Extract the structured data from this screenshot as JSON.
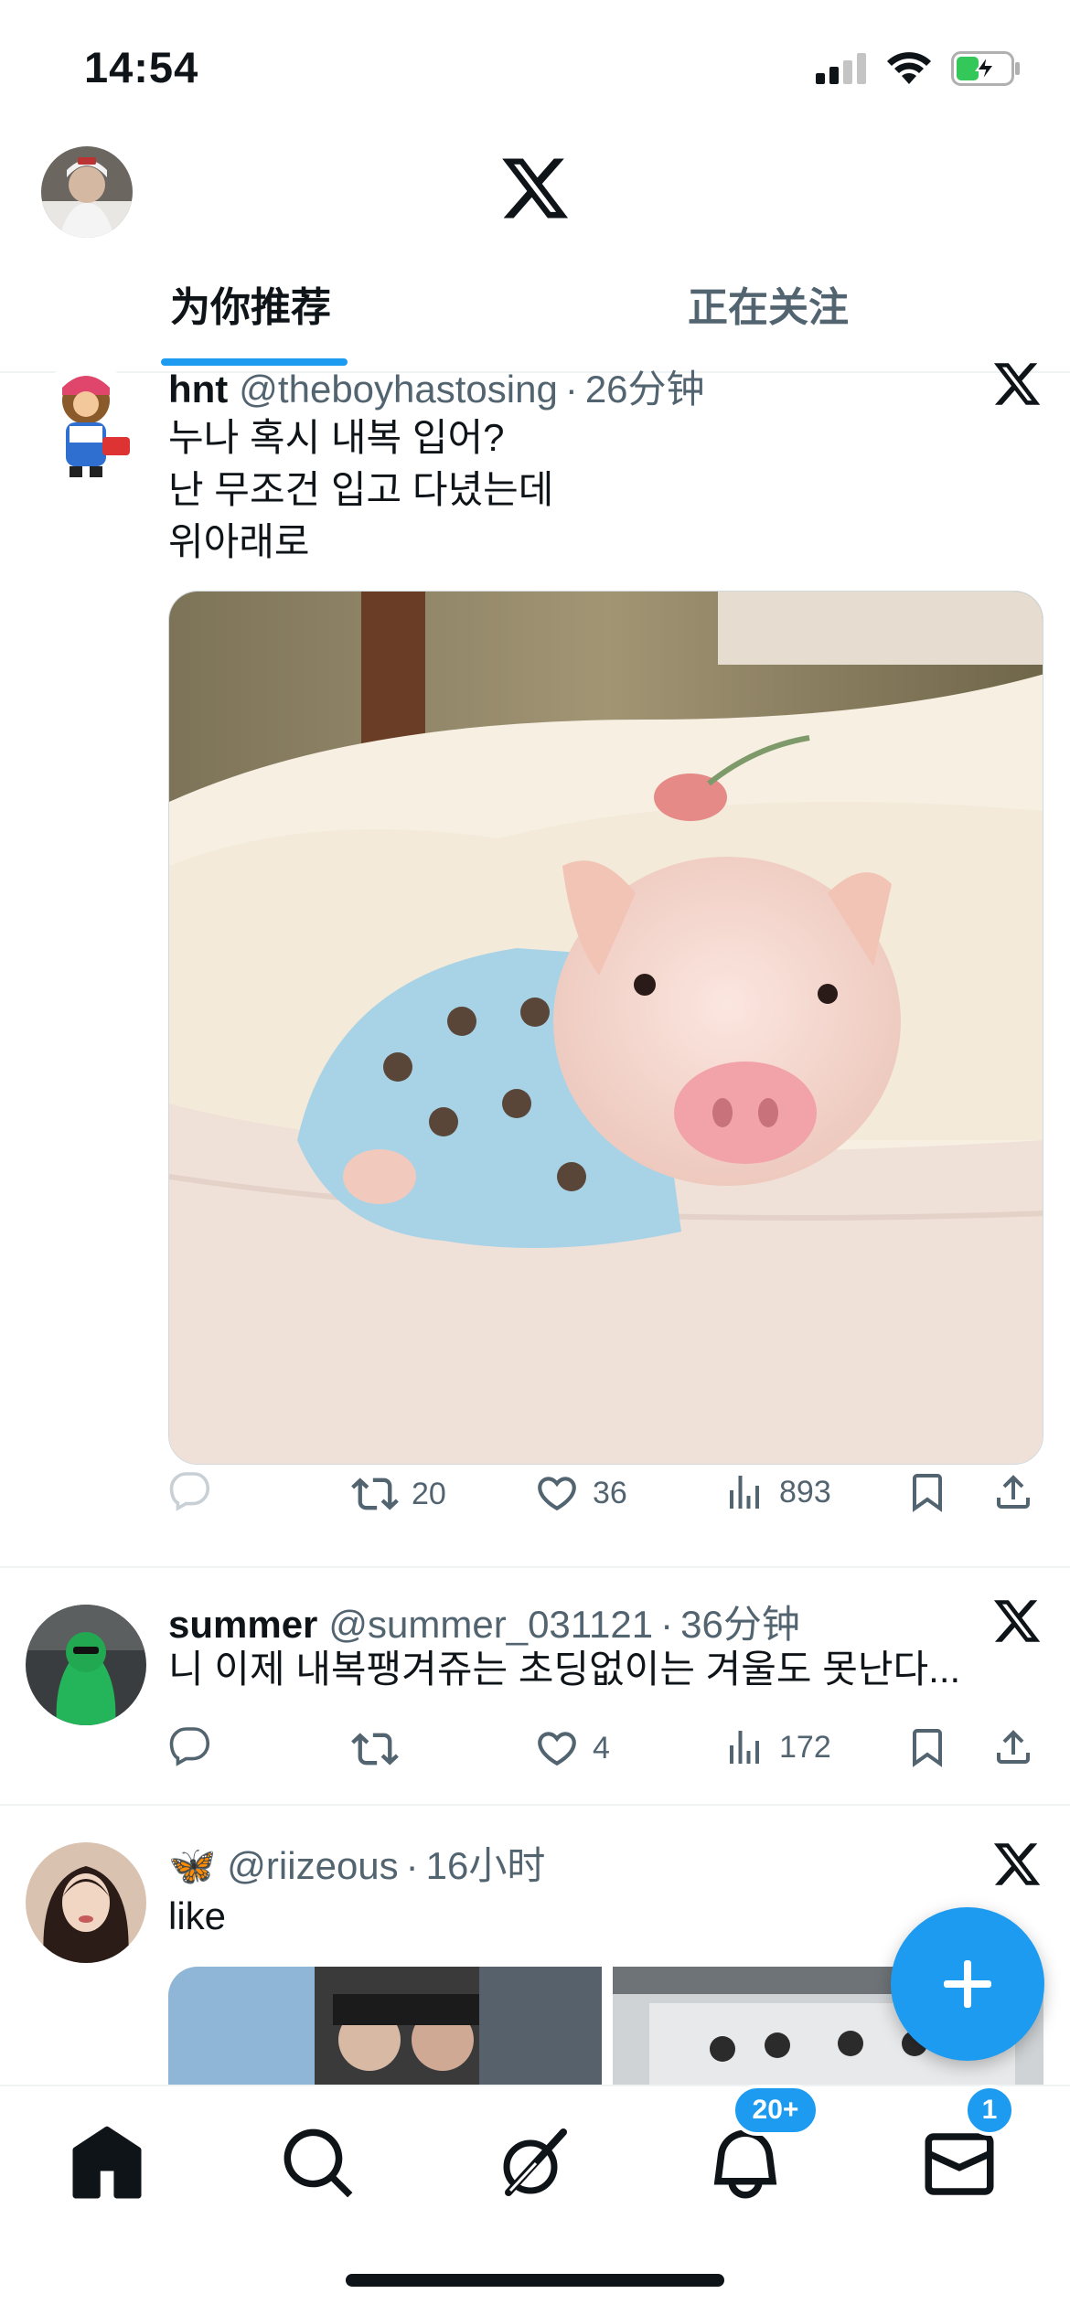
{
  "status_bar": {
    "time": "14:54"
  },
  "header": {
    "tabs": [
      {
        "label": "为你推荐",
        "active": true
      },
      {
        "label": "正在关注",
        "active": false
      }
    ]
  },
  "tweets": [
    {
      "name": "hnt",
      "handle": "@theboyhastosing",
      "separator": "·",
      "time": "26分钟",
      "text": "누나 혹시 내복 입어?\n난 무조건 입고 다녔는데\n위아래로",
      "retweets": "20",
      "likes": "36",
      "views": "893"
    },
    {
      "name": "summer",
      "handle": "@summer_031121",
      "separator": "·",
      "time": "36分钟",
      "text": "니 이제 내복팽겨쥬는 초딩없이는 겨울도 못난다...",
      "retweets": "",
      "likes": "4",
      "views": "172"
    },
    {
      "name": "🦋",
      "handle": "@riizeous",
      "separator": "·",
      "time": "16小时",
      "text": "like"
    }
  ],
  "bottom_nav": {
    "notifications_badge": "20+",
    "messages_badge": "1"
  },
  "colors": {
    "accent": "#1d9bf0",
    "text_primary": "#0f1419",
    "text_secondary": "#536471",
    "divider": "#eff3f4"
  }
}
